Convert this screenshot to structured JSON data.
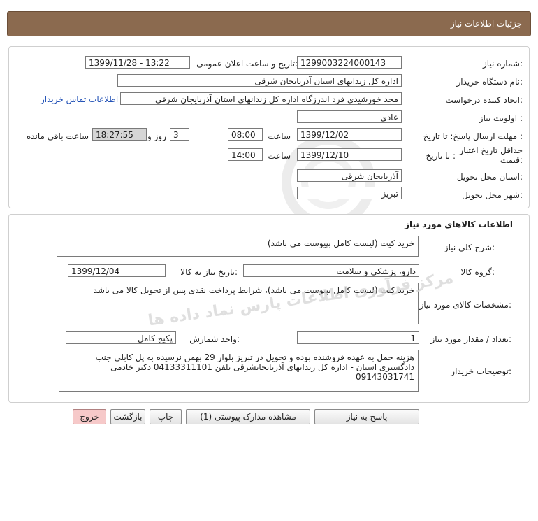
{
  "header": {
    "title": "جزئیات اطلاعات نیاز"
  },
  "info": {
    "need_number_label": "شماره نیاز:",
    "need_number": "1299003224000143",
    "announce_label": "تاریخ و ساعت اعلان عمومی:",
    "announce_value": "1399/11/28 - 13:22",
    "buyer_org_label": "نام دستگاه خریدار:",
    "buyer_org": "اداره کل زندانهای استان آذربایجان شرقی",
    "creator_label": "ایجاد کننده درخواست:",
    "creator": "مجد خورشیدی فرد اندرزگاه اداره کل زندانهای استان آذربایجان شرقی",
    "contact_link": "اطلاعات تماس خریدار",
    "priority_label": "اولویت نیاز :",
    "priority": "عادي",
    "deadline_label": "مهلت ارسال پاسخ: تا تاریخ :",
    "deadline_date": "1399/12/02",
    "time_label": "ساعت",
    "deadline_time": "08:00",
    "days": "3",
    "days_label": "روز و",
    "remaining": "18:27:55",
    "remaining_label": "ساعت باقی مانده",
    "price_validity_label_1": "حداقل تاریخ اعتبار",
    "price_validity_label_2": "قیمت:",
    "price_to_label": "تا تاریخ :",
    "price_date": "1399/12/10",
    "price_time": "14:00",
    "province_label": "استان محل تحویل:",
    "province": "آذربایجان شرقی",
    "city_label": "شهر محل تحویل:",
    "city": "تبریز"
  },
  "goods": {
    "section_title": "اطلاعات کالاهای مورد نیاز",
    "summary_label": "شرح کلی نیاز:",
    "summary": "خرید کیت (لیست کامل بپیوست می باشد)",
    "group_label": "گروه کالا:",
    "group": "دارو، پزشکی و سلامت",
    "need_date_label": "تاریخ نیاز به کالا:",
    "need_date": "1399/12/04",
    "spec_label": "مشخصات کالای مورد نیاز:",
    "spec": "خرید کیت (لیست کامل بپیوست می باشد)، شرایط پرداخت نقدی پس از تحویل کالا می باشد",
    "qty_label": "تعداد / مقدار مورد نیاز:",
    "qty": "1",
    "unit_label": "واحد شمارش:",
    "unit": "پکیج کامل",
    "buyer_notes_label": "توضیحات خریدار:",
    "buyer_notes": "هزینه حمل به عهده فروشنده بوده و تحویل در تبریز بلوار 29 بهمن نرسیده به پل کابلی جنب دادگستری استان - اداره کل زندانهای آذربایجانشرقی تلفن 04133311101 دکتر خادمی 09143031741"
  },
  "buttons": {
    "reply": "پاسخ به نیاز",
    "attachments": "مشاهده مدارک پیوستی (1)",
    "print": "چاپ",
    "back": "بازگشت",
    "exit": "خروج"
  }
}
